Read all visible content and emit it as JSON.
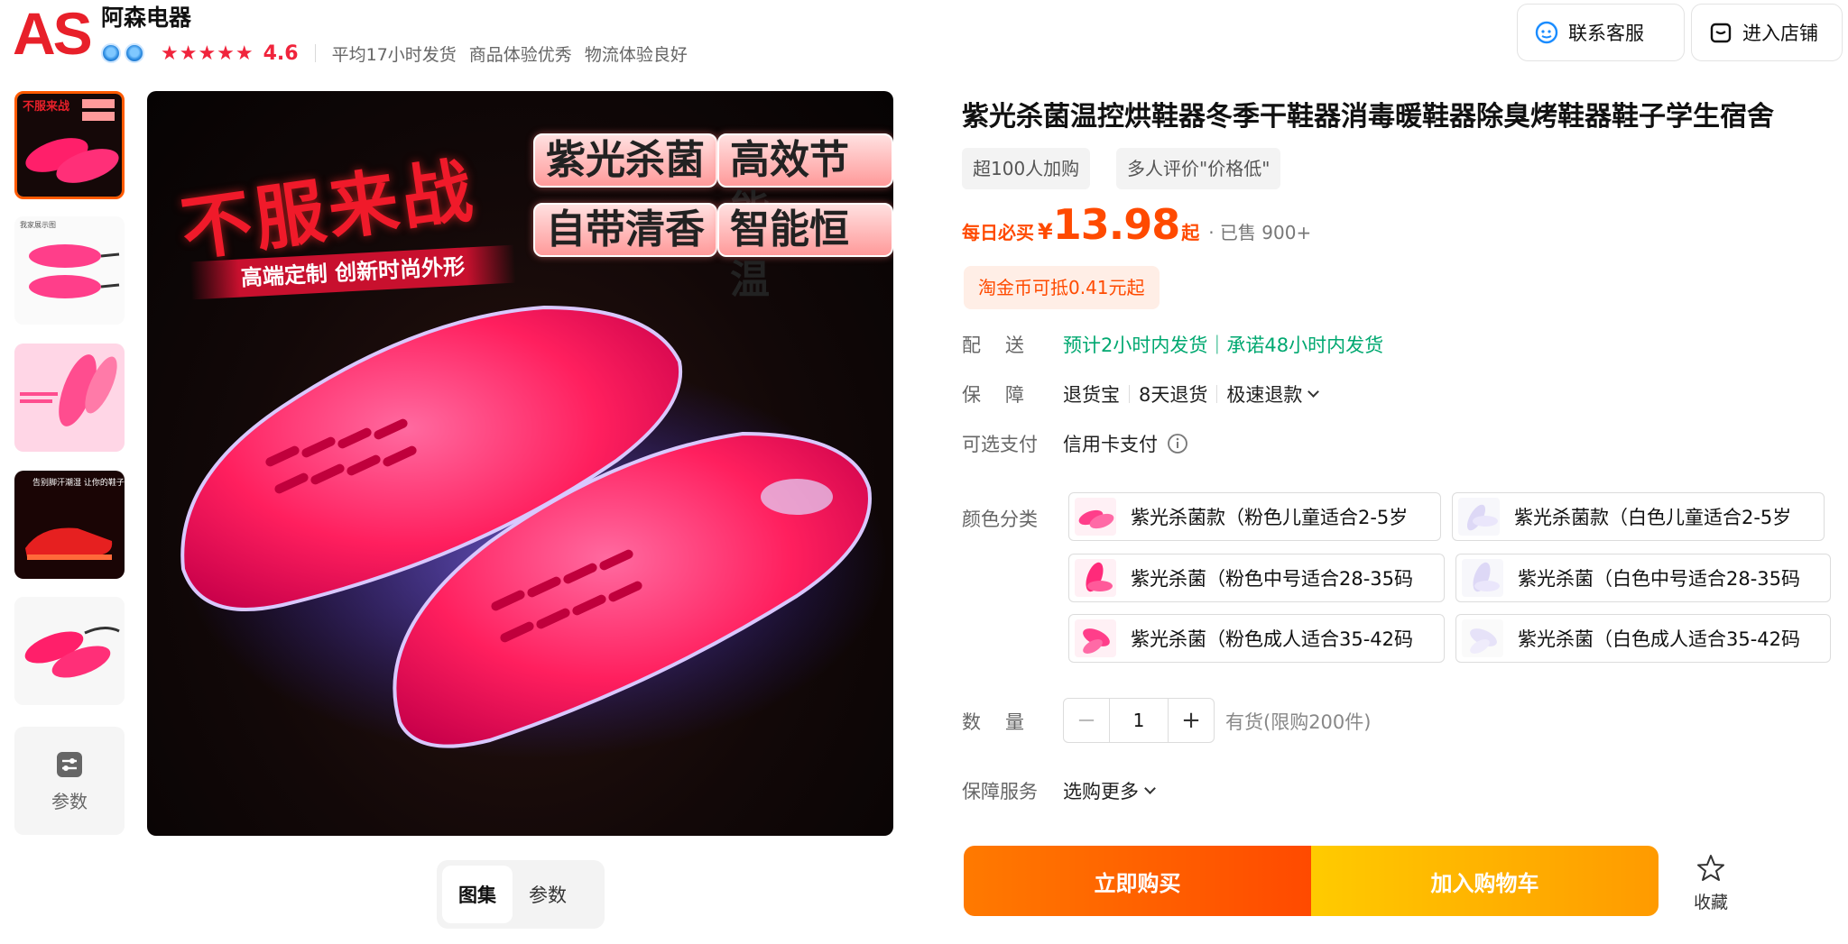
{
  "shop": {
    "logo_text": "AS",
    "name": "阿森电器",
    "rating": "4.6",
    "tags": [
      "平均17小时发货",
      "商品体验优秀",
      "物流体验良好"
    ]
  },
  "header_buttons": {
    "service_label": "联系客服",
    "store_label": "进入店铺"
  },
  "main_image": {
    "badges": [
      "紫光杀菌",
      "高效节能",
      "自带清香",
      "智能恒温"
    ],
    "slogan": "不服来战",
    "sub_slogan": "高端定制 创新时尚外形"
  },
  "gallery": {
    "params_label": "参数",
    "tabs": [
      "图集",
      "参数"
    ],
    "thumb_captions": [
      "不服来战",
      "我家展示图",
      "告别脚汗潮湿 让你的鞋子暖起来"
    ]
  },
  "product": {
    "title": "紫光杀菌温控烘鞋器冬季干鞋器消毒暖鞋器除臭烤鞋器鞋子学生宿舍",
    "chips": [
      "超100人加购",
      "多人评价\"价格低\""
    ],
    "price_label": "每日必买",
    "price_currency": "¥",
    "price_value": "13.98",
    "price_suffix": "起",
    "sold": "· 已售 900+",
    "coin_tag": "淘金币可抵0.41元起"
  },
  "rows": {
    "delivery_label": "配送",
    "delivery_value": "预计2小时内发货｜承诺48小时内发货",
    "guarantee_label": "保障",
    "guarantee_items": [
      "退货宝",
      "8天退货",
      "极速退款"
    ],
    "payment_label": "可选支付",
    "payment_value": "信用卡支付",
    "color_label": "颜色分类",
    "quantity_label": "数量",
    "service_label": "保障服务",
    "service_value": "选购更多"
  },
  "skus": [
    {
      "label": "紫光杀菌款（粉色儿童适合2-5岁",
      "color": "pink"
    },
    {
      "label": "紫光杀菌款（白色儿童适合2-5岁",
      "color": "white"
    },
    {
      "label": "紫光杀菌（粉色中号适合28-35码",
      "color": "pink"
    },
    {
      "label": "紫光杀菌（白色中号适合28-35码",
      "color": "white"
    },
    {
      "label": "紫光杀菌（粉色成人适合35-42码",
      "color": "pink"
    },
    {
      "label": "紫光杀菌（白色成人适合35-42码",
      "color": "white"
    }
  ],
  "quantity": {
    "minus": "−",
    "value": "1",
    "plus": "+",
    "stock": "有货(限购200件)"
  },
  "actions": {
    "buy_now": "立即购买",
    "add_cart": "加入购物车",
    "favorite": "收藏"
  },
  "colors": {
    "accent": "#ff4a00",
    "rating": "#f0243c",
    "green": "#00a870",
    "logo": "#e8202a"
  }
}
